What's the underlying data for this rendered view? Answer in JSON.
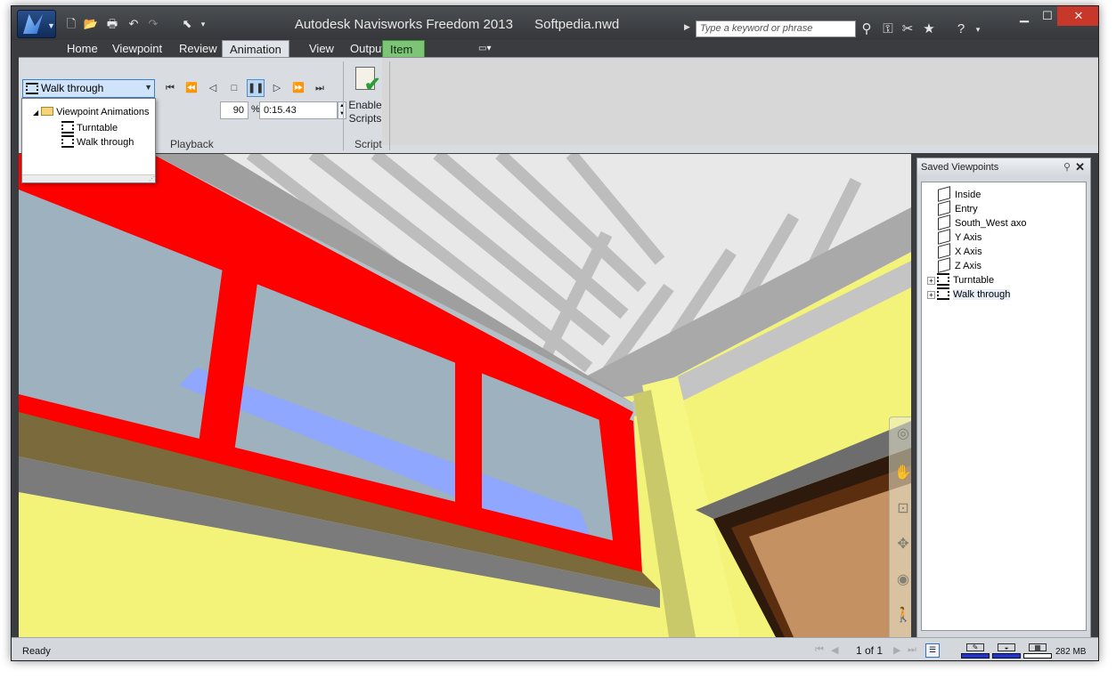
{
  "titlebar": {
    "app_name": "Autodesk Navisworks Freedom 2013",
    "file_name": "Softpedia.nwd",
    "search_placeholder": "Type a keyword or phrase",
    "minimize": "▁",
    "maximize": "☐",
    "close": "✕"
  },
  "tabs": [
    "Home",
    "Viewpoint",
    "Review",
    "Animation",
    "View",
    "Output",
    "Item Tools"
  ],
  "ribbon": {
    "animation_selected": "Walk through",
    "speed_value": "90",
    "percent_symbol": "%",
    "time_value": "0:15.43",
    "playback_label": "Playback",
    "script_label": "Script",
    "enable_scripts_label": "Enable Scripts"
  },
  "dropdown": {
    "folder": "Viewpoint Animations",
    "items": [
      "Turntable",
      "Walk through"
    ]
  },
  "saved_viewpoints": {
    "title": "Saved Viewpoints",
    "items": [
      {
        "label": "Inside",
        "kind": "viewpoint"
      },
      {
        "label": "Entry",
        "kind": "viewpoint"
      },
      {
        "label": "South_West axo",
        "kind": "viewpoint"
      },
      {
        "label": "Y Axis",
        "kind": "viewpoint"
      },
      {
        "label": "X Axis",
        "kind": "viewpoint"
      },
      {
        "label": "Z Axis",
        "kind": "viewpoint"
      },
      {
        "label": "Turntable",
        "kind": "animation"
      },
      {
        "label": "Walk through",
        "kind": "animation"
      }
    ]
  },
  "statusbar": {
    "status": "Ready",
    "page": "1 of 1",
    "memory": "282 MB"
  },
  "colors": {
    "frame_red": "#ff0000",
    "wall_yellow": "#f3f37a",
    "glass_blue": "#9db1bf",
    "accent_blue": "#1f33d6"
  }
}
